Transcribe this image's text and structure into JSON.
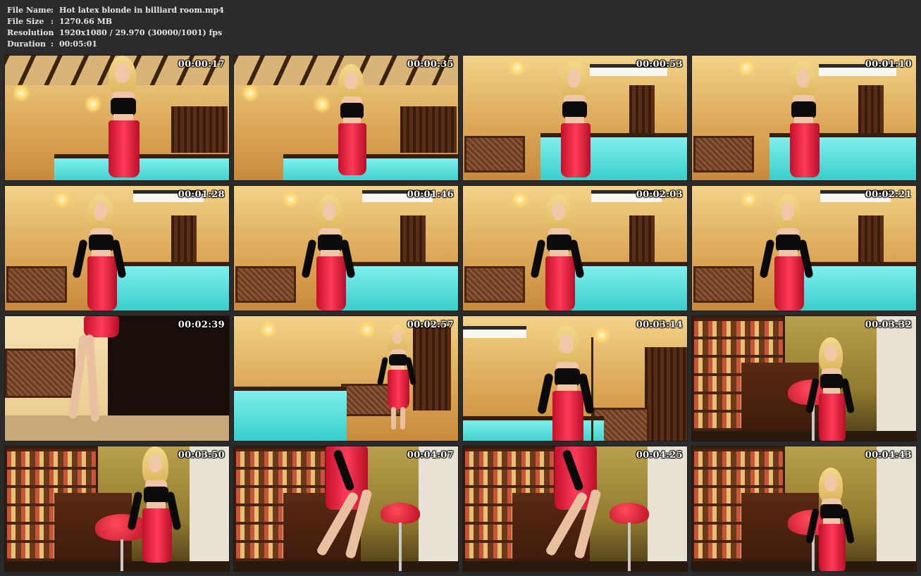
{
  "info": {
    "rows": [
      {
        "label": "File Name",
        "sep": ":",
        "value": "Hot latex blonde in billiard room.mp4"
      },
      {
        "label": "File Size",
        "sep": ":",
        "value": "1270.66 MB"
      },
      {
        "label": "Resolution",
        "sep": ":",
        "value": "1920x1080 / 29.970 (30000/1001) fps"
      },
      {
        "label": "Duration",
        "sep": ":",
        "value": "00:05:01"
      }
    ]
  },
  "thumbnails": [
    {
      "timestamp": "00:00:17",
      "scene": "billiard-ceiling"
    },
    {
      "timestamp": "00:00:35",
      "scene": "billiard-ceiling-sit"
    },
    {
      "timestamp": "00:00:53",
      "scene": "billiard-table"
    },
    {
      "timestamp": "00:01:10",
      "scene": "billiard-table"
    },
    {
      "timestamp": "00:01:28",
      "scene": "billiard-heater"
    },
    {
      "timestamp": "00:01:46",
      "scene": "billiard-heater"
    },
    {
      "timestamp": "00:02:03",
      "scene": "billiard-heater"
    },
    {
      "timestamp": "00:02:21",
      "scene": "billiard-heater"
    },
    {
      "timestamp": "00:02:39",
      "scene": "legs-heels"
    },
    {
      "timestamp": "00:02:57",
      "scene": "billiard-wide"
    },
    {
      "timestamp": "00:03:14",
      "scene": "billiard-cue"
    },
    {
      "timestamp": "00:03:32",
      "scene": "bar-stool"
    },
    {
      "timestamp": "00:03:50",
      "scene": "bar-standing"
    },
    {
      "timestamp": "00:04:07",
      "scene": "bar-legs"
    },
    {
      "timestamp": "00:04:25",
      "scene": "bar-legs"
    },
    {
      "timestamp": "00:04:43",
      "scene": "bar-stool"
    }
  ]
}
